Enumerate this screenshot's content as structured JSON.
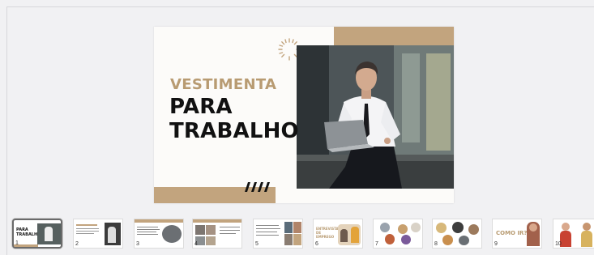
{
  "slide": {
    "title_line1": "VESTIMENTA",
    "title_line2": "PARA",
    "title_line3": "TRABALHO"
  },
  "thumbnails": [
    {
      "number": "1",
      "text": "PARA TRABALHO",
      "selected": true
    },
    {
      "number": "2",
      "text": ""
    },
    {
      "number": "3",
      "text": ""
    },
    {
      "number": "4",
      "text": ""
    },
    {
      "number": "5",
      "text": ""
    },
    {
      "number": "6",
      "text": "ENTREVISTA DE EMPREGO"
    },
    {
      "number": "7",
      "text": ""
    },
    {
      "number": "8",
      "text": ""
    },
    {
      "number": "9",
      "text": "COMO IR?"
    },
    {
      "number": "10",
      "text": ""
    }
  ],
  "colors": {
    "accent_tan": "#c2a47e",
    "title_tan": "#b89b72",
    "title_dark": "#111111",
    "background": "#f1f1f3"
  }
}
